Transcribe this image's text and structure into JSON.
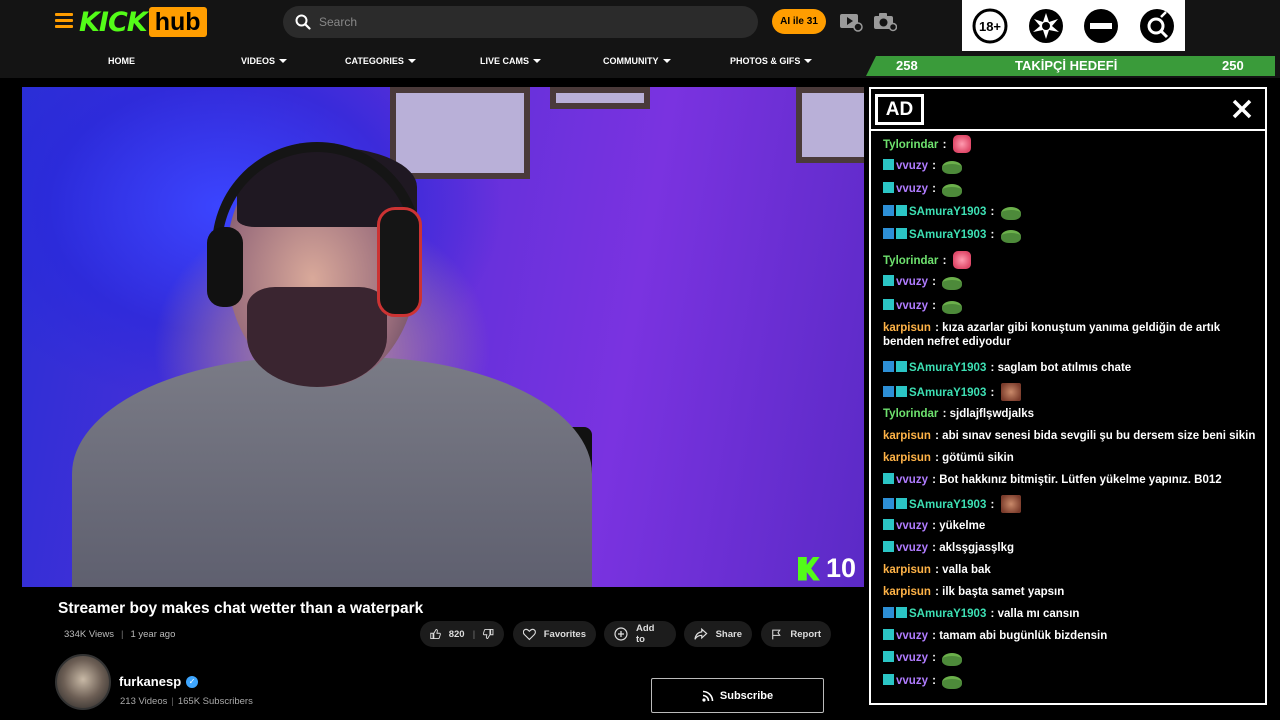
{
  "header": {
    "logo_kick": "KICK",
    "logo_hub": "hub",
    "search_placeholder": "Search",
    "ai_label": "AI ile 31",
    "nav": [
      {
        "label": "HOME",
        "dropdown": false
      },
      {
        "label": "VIDEOS",
        "dropdown": true
      },
      {
        "label": "CATEGORIES",
        "dropdown": true
      },
      {
        "label": "LIVE CAMS",
        "dropdown": true
      },
      {
        "label": "COMMUNITY",
        "dropdown": true
      },
      {
        "label": "PHOTOS & GIFS",
        "dropdown": true
      }
    ]
  },
  "badges": [
    {
      "icon": "18-plus-icon",
      "text": "18+"
    },
    {
      "icon": "explicit-burst-icon"
    },
    {
      "icon": "no-entry-icon"
    },
    {
      "icon": "gender-search-icon"
    }
  ],
  "goal": {
    "current": "258",
    "label": "TAKİPÇİ HEDEFİ",
    "target": "250",
    "color": "#3a9b3a"
  },
  "video": {
    "title": "Streamer boy makes chat wetter than a waterpark",
    "views": "334K Views",
    "age": "1 year ago",
    "overlay_count": "10",
    "likes": "820",
    "actions": {
      "favorites": "Favorites",
      "add_to": "Add to",
      "share": "Share",
      "report": "Report"
    }
  },
  "channel": {
    "name": "furkanesp",
    "videos": "213 Videos",
    "subscribers": "165K Subscribers",
    "subscribe_label": "Subscribe"
  },
  "chat": {
    "ad_label": "AD",
    "messages": [
      {
        "user": "Tylorindar",
        "cls": "u-tylor",
        "badges": [],
        "text": "",
        "emote": "e-pink"
      },
      {
        "user": "vvuzy",
        "cls": "u-vvuzy",
        "badges": [
          "b-teal"
        ],
        "text": "",
        "emote": "e-frog"
      },
      {
        "user": "vvuzy",
        "cls": "u-vvuzy",
        "badges": [
          "b-teal"
        ],
        "text": "",
        "emote": "e-frog"
      },
      {
        "user": "SAmuraY1903",
        "cls": "u-sam",
        "badges": [
          "b-blue",
          "b-teal"
        ],
        "text": "",
        "emote": "e-frog"
      },
      {
        "user": "SAmuraY1903",
        "cls": "u-sam",
        "badges": [
          "b-blue",
          "b-teal"
        ],
        "text": "",
        "emote": "e-frog"
      },
      {
        "user": "Tylorindar",
        "cls": "u-tylor",
        "badges": [],
        "text": "",
        "emote": "e-pink"
      },
      {
        "user": "vvuzy",
        "cls": "u-vvuzy",
        "badges": [
          "b-teal"
        ],
        "text": "",
        "emote": "e-frog"
      },
      {
        "user": "vvuzy",
        "cls": "u-vvuzy",
        "badges": [
          "b-teal"
        ],
        "text": "",
        "emote": "e-frog"
      },
      {
        "user": "karpisun",
        "cls": "u-karp",
        "badges": [],
        "text": "kıza azarlar gibi konuştum yanıma geldiğin de artık benden nefret ediyodur",
        "emote": ""
      },
      {
        "user": "SAmuraY1903",
        "cls": "u-sam",
        "badges": [
          "b-blue",
          "b-teal"
        ],
        "text": "saglam bot atılmıs chate",
        "emote": ""
      },
      {
        "user": "SAmuraY1903",
        "cls": "u-sam",
        "badges": [
          "b-blue",
          "b-teal"
        ],
        "text": "",
        "emote": "e-face"
      },
      {
        "user": "Tylorindar",
        "cls": "u-tylor",
        "badges": [],
        "text": "sjdlajflşwdjalks",
        "emote": ""
      },
      {
        "user": "karpisun",
        "cls": "u-karp",
        "badges": [],
        "text": "abi sınav senesi bida sevgili şu bu dersem size beni sikin",
        "emote": ""
      },
      {
        "user": "karpisun",
        "cls": "u-karp",
        "badges": [],
        "text": "götümü sikin",
        "emote": ""
      },
      {
        "user": "vvuzy",
        "cls": "u-vvuzy",
        "badges": [
          "b-teal"
        ],
        "text": "Bot hakkınız bitmiştir. Lütfen yükelme yapınız. B012",
        "emote": ""
      },
      {
        "user": "SAmuraY1903",
        "cls": "u-sam",
        "badges": [
          "b-blue",
          "b-teal"
        ],
        "text": "",
        "emote": "e-face"
      },
      {
        "user": "vvuzy",
        "cls": "u-vvuzy",
        "badges": [
          "b-teal"
        ],
        "text": "yükelme",
        "emote": ""
      },
      {
        "user": "vvuzy",
        "cls": "u-vvuzy",
        "badges": [
          "b-teal"
        ],
        "text": "aklsşgjasşlkg",
        "emote": ""
      },
      {
        "user": "karpisun",
        "cls": "u-karp",
        "badges": [],
        "text": "valla bak",
        "emote": ""
      },
      {
        "user": "karpisun",
        "cls": "u-karp",
        "badges": [],
        "text": "ilk başta samet yapsın",
        "emote": ""
      },
      {
        "user": "SAmuraY1903",
        "cls": "u-sam",
        "badges": [
          "b-blue",
          "b-teal"
        ],
        "text": "valla mı cansın",
        "emote": ""
      },
      {
        "user": "vvuzy",
        "cls": "u-vvuzy",
        "badges": [
          "b-teal"
        ],
        "text": "tamam abi bugünlük bizdensin",
        "emote": ""
      },
      {
        "user": "vvuzy",
        "cls": "u-vvuzy",
        "badges": [
          "b-teal"
        ],
        "text": "",
        "emote": "e-frog"
      },
      {
        "user": "vvuzy",
        "cls": "u-vvuzy",
        "badges": [
          "b-teal"
        ],
        "text": "",
        "emote": "e-frog"
      }
    ]
  }
}
